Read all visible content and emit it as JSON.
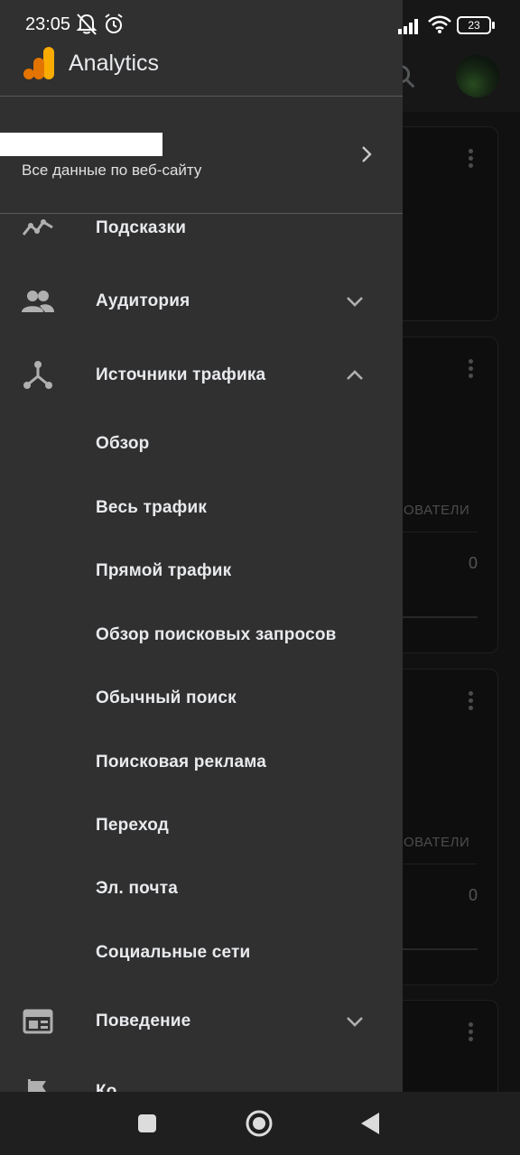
{
  "status_bar": {
    "time": "23:05",
    "battery": "23"
  },
  "app": {
    "name": "Analytics"
  },
  "account": {
    "subtitle": "Все данные по веб-сайту"
  },
  "nav": {
    "items": [
      {
        "label": "Подсказки",
        "icon": "insights-icon"
      },
      {
        "label": "Аудитория",
        "icon": "people-icon",
        "expanded": false
      },
      {
        "label": "Источники трафика",
        "icon": "acquisition-icon",
        "expanded": true
      },
      {
        "label": "Поведение",
        "icon": "behavior-icon",
        "expanded": false
      }
    ],
    "subitems": [
      {
        "label": "Обзор"
      },
      {
        "label": "Весь трафик"
      },
      {
        "label": "Прямой трафик"
      },
      {
        "label": "Обзор поисковых запросов"
      },
      {
        "label": "Обычный поиск"
      },
      {
        "label": "Поисковая реклама"
      },
      {
        "label": "Переход"
      },
      {
        "label": "Эл. почта"
      },
      {
        "label": "Социальные сети"
      }
    ],
    "partial_last_label": "Ко"
  },
  "background": {
    "column_header": "ОВАТЕЛИ",
    "card_values": [
      "0",
      "0"
    ]
  },
  "colors": {
    "drawer_bg": "#303030",
    "logo_orange": "#f9ab00",
    "logo_dark_orange": "#e37400"
  }
}
